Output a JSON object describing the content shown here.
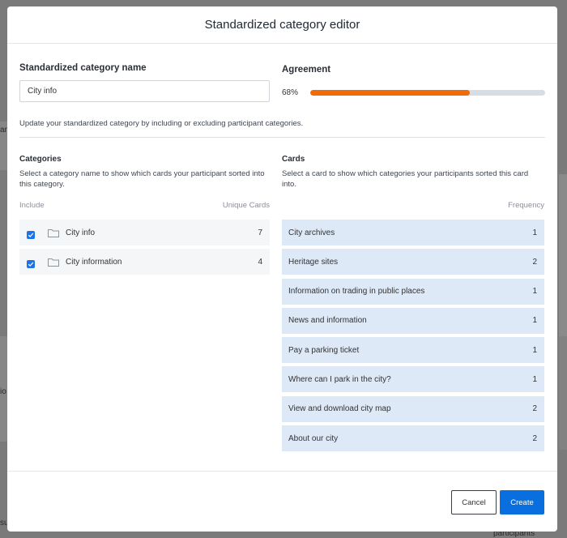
{
  "background": {
    "left_fragments": [
      "an",
      "io",
      "su"
    ],
    "bottom_texts": [
      "participants"
    ]
  },
  "modal": {
    "title": "Standardized category editor",
    "name_label": "Standardized category name",
    "name_value": "City info",
    "agreement_label": "Agreement",
    "agreement_percent_text": "68%",
    "agreement_fraction": 0.68,
    "helper_text": "Update your standardized category by including or excluding participant categories."
  },
  "categories": {
    "title": "Categories",
    "description": "Select a category name to show which cards your participant sorted into this category.",
    "include_header": "Include",
    "count_header": "Unique Cards",
    "items": [
      {
        "name": "City info",
        "count": "7",
        "checked": true
      },
      {
        "name": "City information",
        "count": "4",
        "checked": true
      }
    ]
  },
  "cards": {
    "title": "Cards",
    "description": "Select a card to show which categories your participants sorted this card into.",
    "frequency_header": "Frequency",
    "items": [
      {
        "name": "City archives",
        "freq": "1"
      },
      {
        "name": "Heritage sites",
        "freq": "2"
      },
      {
        "name": "Information on trading in public places",
        "freq": "1"
      },
      {
        "name": "News and information",
        "freq": "1"
      },
      {
        "name": "Pay a parking ticket",
        "freq": "1"
      },
      {
        "name": "Where can I park in the city?",
        "freq": "1"
      },
      {
        "name": "View and download city map",
        "freq": "2"
      },
      {
        "name": "About our city",
        "freq": "2"
      }
    ]
  },
  "footer": {
    "cancel_label": "Cancel",
    "create_label": "Create"
  },
  "colors": {
    "accent": "#0a6fde",
    "progress": "#f06b0a",
    "card_bg": "#dde9f7"
  }
}
